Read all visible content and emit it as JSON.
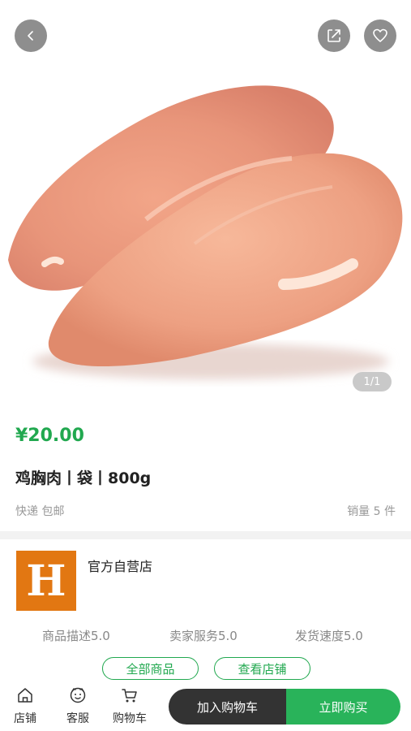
{
  "gallery": {
    "counter": "1/1"
  },
  "product": {
    "price": "¥20.00",
    "title": "鸡胸肉丨袋丨800g",
    "shipping": "快递 包邮",
    "sales": "销量 5 件"
  },
  "store": {
    "logo_letter": "H",
    "name": "官方自营店",
    "ratings": [
      "商品描述5.0",
      "卖家服务5.0",
      "发货速度5.0"
    ],
    "buttons": {
      "all_products": "全部商品",
      "view_store": "查看店铺"
    }
  },
  "bottom_bar": {
    "nav": [
      {
        "label": "店铺",
        "icon": "home-icon"
      },
      {
        "label": "客服",
        "icon": "customer-service-icon"
      },
      {
        "label": "购物车",
        "icon": "cart-icon"
      }
    ],
    "add_to_cart": "加入购物车",
    "buy_now": "立即购买"
  },
  "colors": {
    "accent": "#21a84f",
    "buy_button": "#29b35a",
    "cart_button": "#333333",
    "logo_bg": "#e27712"
  }
}
